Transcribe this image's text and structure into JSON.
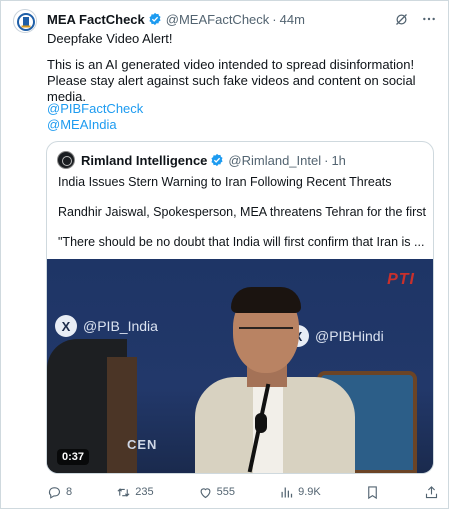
{
  "tweet": {
    "author_name": "MEA FactCheck",
    "author_handle": "@MEAFactCheck",
    "separator": "·",
    "time": "44m",
    "line1": "Deepfake Video Alert!",
    "line2": "This is an AI generated video intended to spread disinformation! Please stay alert against such fake videos and content on social media.",
    "mentions": [
      "@PIBFactCheck",
      "@MEAIndia"
    ]
  },
  "quote": {
    "author_name": "Rimland Intelligence",
    "author_handle": "@Rimland_Intel",
    "separator": "·",
    "time": "1h",
    "line1": "India Issues Stern Warning to Iran Following Recent Threats",
    "line2": "Randhir Jaiswal, Spokesperson, MEA threatens Tehran for the first time,",
    "line3": "\"There should be no doubt that India will first confirm that Iran is ...",
    "video": {
      "left_logo": "@PIB_India",
      "right_logo": "@PIBHindi",
      "watermark": "PTI",
      "backdrop_text": "CEN",
      "duration": "0:37"
    }
  },
  "actions": {
    "replies": "8",
    "reposts": "235",
    "likes": "555",
    "views": "9.9K"
  },
  "colors": {
    "link": "#1d9bf0",
    "secondary_text": "#536471",
    "verified": "#1d9bf0",
    "border": "#cfd9de"
  }
}
